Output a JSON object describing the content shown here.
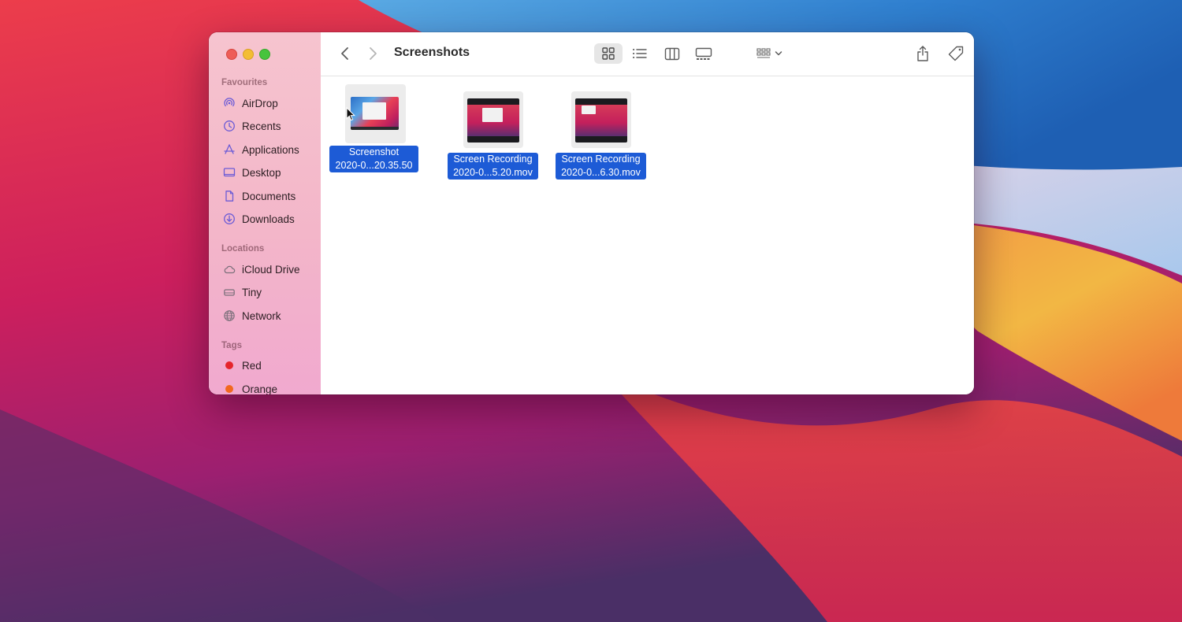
{
  "window": {
    "title": "Screenshots"
  },
  "sidebar": {
    "favourites_header": "Favourites",
    "favourites": [
      {
        "label": "AirDrop",
        "icon": "airdrop-icon"
      },
      {
        "label": "Recents",
        "icon": "clock-icon"
      },
      {
        "label": "Applications",
        "icon": "applications-icon"
      },
      {
        "label": "Desktop",
        "icon": "desktop-icon"
      },
      {
        "label": "Documents",
        "icon": "document-icon"
      },
      {
        "label": "Downloads",
        "icon": "download-icon"
      }
    ],
    "locations_header": "Locations",
    "locations": [
      {
        "label": "iCloud Drive",
        "icon": "cloud-icon"
      },
      {
        "label": "Tiny",
        "icon": "drive-icon"
      },
      {
        "label": "Network",
        "icon": "globe-icon"
      }
    ],
    "tags_header": "Tags",
    "tags": [
      {
        "label": "Red",
        "color": "#e5242b"
      },
      {
        "label": "Orange",
        "color": "#f2681e"
      }
    ]
  },
  "files": [
    {
      "line1": "Screenshot",
      "line2": "2020-0...20.35.50",
      "selected": true
    },
    {
      "line1": "Screen Recording",
      "line2": "2020-0...5.20.mov",
      "selected": true
    },
    {
      "line1": "Screen Recording",
      "line2": "2020-0...6.30.mov",
      "selected": true
    }
  ],
  "colors": {
    "accent": "#1d5bd6",
    "sidebar": "#f4b9cb",
    "close": "#ee5d57",
    "minimize": "#f3bd34",
    "zoom": "#48c43d"
  }
}
